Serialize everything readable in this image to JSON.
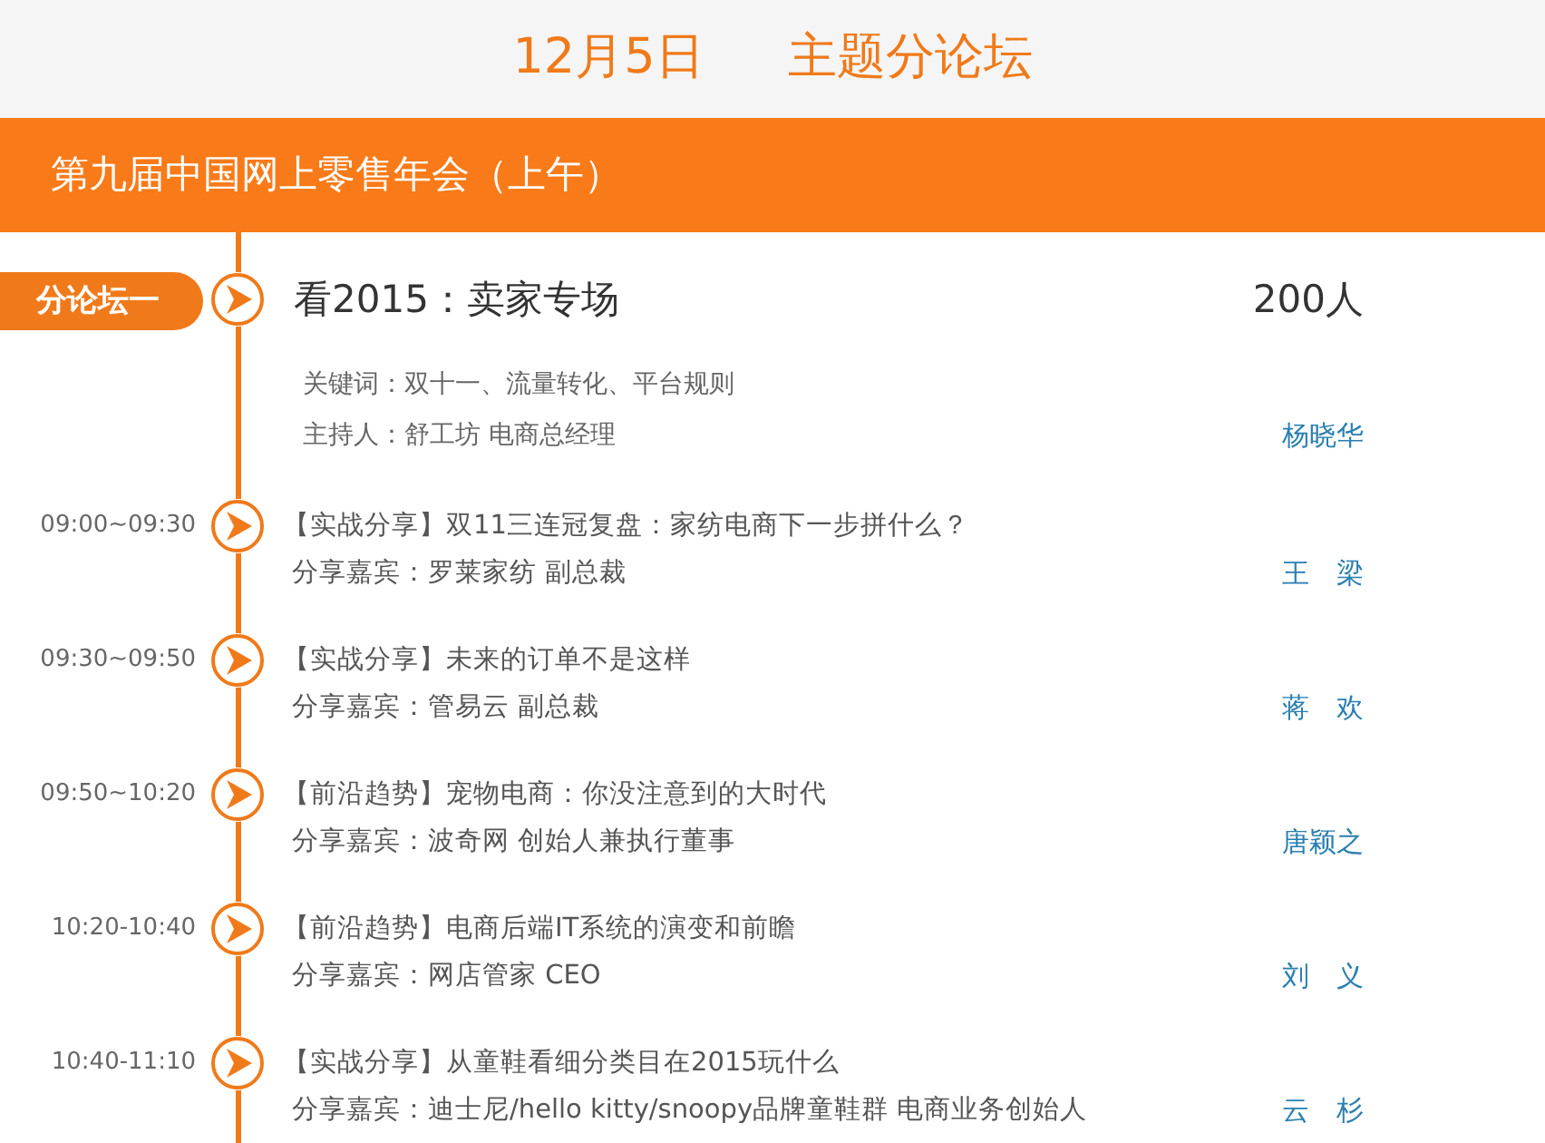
{
  "header": {
    "date": "12月5日",
    "title": "主题分论坛"
  },
  "banner": "第九届中国网上零售年会（上午）",
  "forum": {
    "tag": "分论坛一",
    "title": "看2015：卖家专场",
    "capacity": "200人",
    "keywords": "关键词：双十一、流量转化、平台规则",
    "host": "主持人：舒工坊 电商总经理",
    "host_name": "杨晓华"
  },
  "sessions": [
    {
      "time": "09:00~09:30",
      "title": "【实战分享】双11三连冠复盘：家纺电商下一步拼什么？",
      "speaker": "分享嘉宾：罗莱家纺 副总裁",
      "name": "王　梁"
    },
    {
      "time": "09:30~09:50",
      "title": "【实战分享】未来的订单不是这样",
      "speaker": "分享嘉宾：管易云 副总裁",
      "name": "蒋　欢"
    },
    {
      "time": "09:50~10:20",
      "title": "【前沿趋势】宠物电商：你没注意到的大时代",
      "speaker": "分享嘉宾：波奇网 创始人兼执行董事",
      "name": "唐颖之"
    },
    {
      "time": "10:20-10:40",
      "title": "【前沿趋势】电商后端IT系统的演变和前瞻",
      "speaker": "分享嘉宾：网店管家 CEO",
      "name": "刘　义"
    },
    {
      "time": "10:40-11:10",
      "title": "【实战分享】从童鞋看细分类目在2015玩什么",
      "speaker": "分享嘉宾：迪士尼/hello kitty/snoopy品牌童鞋群 电商业务创始人",
      "name": "云　杉"
    }
  ]
}
